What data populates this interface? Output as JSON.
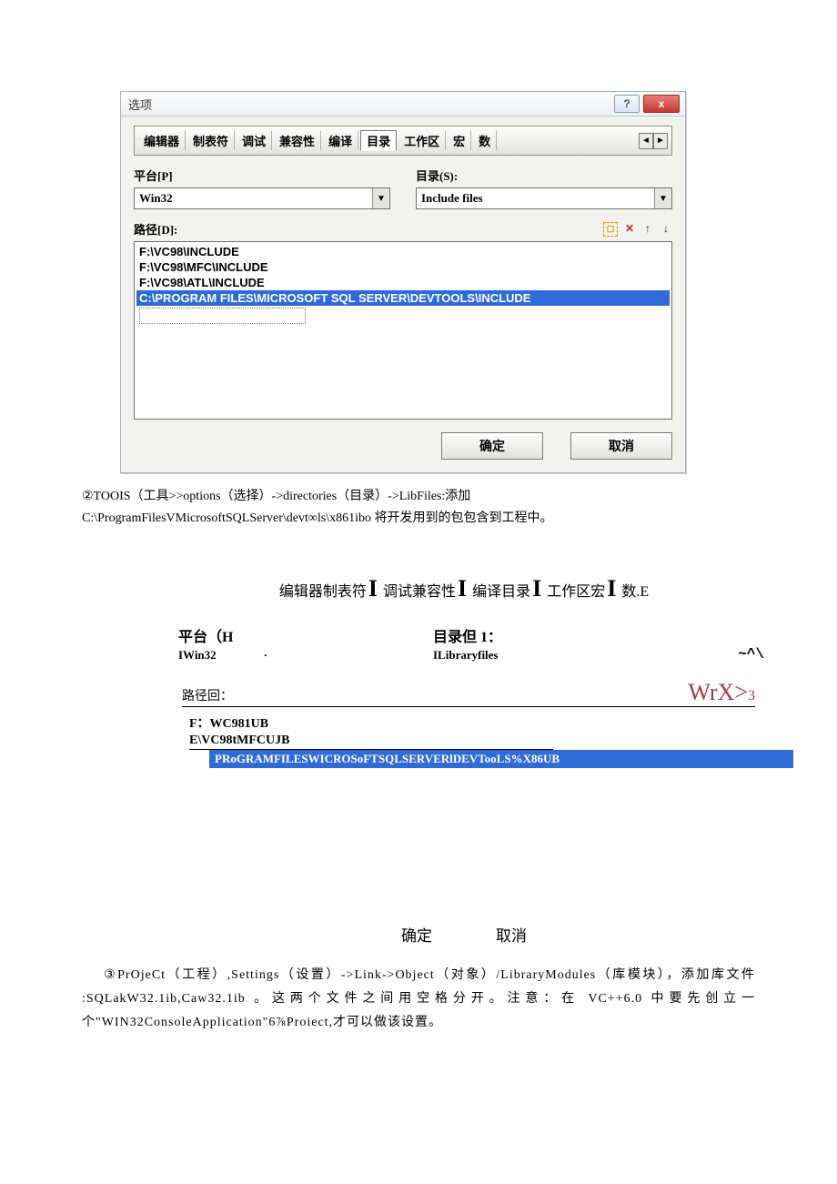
{
  "dlg1": {
    "title": "选项",
    "help_btn": "?",
    "close_btn": "x",
    "tabs": [
      "编辑器",
      "制表符",
      "调试",
      "兼容性",
      "编译",
      "目录",
      "工作区",
      "宏",
      "数"
    ],
    "arrow_left": "◄",
    "arrow_right": "►",
    "platform_label": "平台[P]",
    "platform_value": "Win32",
    "dirtype_label": "目录(S):",
    "dirtype_value": "Include files",
    "paths_label": "路径[D]:",
    "icon_new": "▢",
    "icon_del": "✕",
    "icon_up": "↑",
    "icon_down": "↓",
    "paths": [
      "F:\\VC98\\INCLUDE",
      "F:\\VC98\\MFC\\INCLUDE",
      "F:\\VC98\\ATL\\INCLUDE",
      "C:\\PROGRAM FILES\\MICROSOFT SQL SERVER\\DEVTOOLS\\INCLUDE"
    ],
    "ok": "确定",
    "cancel": "取消"
  },
  "para2a": "②TOOIS（工具>>options（选择）->directories（目录）->LibFiles:添加",
  "para2b": "C:\\ProgramFilesVMicrosoftSQLServer\\devt∞ls\\x861ibo 将开发用到的包包含到工程中。",
  "dlg2": {
    "tabs_text": [
      "编辑器制表符",
      "调试兼容性",
      "编译目录",
      "工作区宏",
      "数.E"
    ],
    "platform_label": "平台（H",
    "platform_value": "IWin32",
    "platform_dot": "·",
    "dirtype_label": "目录但 1：",
    "dirtype_value": "ILibraryfiles",
    "tail": "~^\\",
    "paths_label": "路径回：",
    "wrx": "WrX>",
    "wrx3": "3",
    "p1": "F：WC981UB",
    "p2": "E\\VC98tMFCUJB",
    "p3": "PRoGRAMFILESWICROSoFTSQLSERVERlDEVTooLS%X86UB",
    "ok": "确定",
    "cancel": "取消"
  },
  "para3": "③PrOjeCt（工程）,Settings（设置）->Link->Object（对象）/LibraryModules（库模块），添加库文件 :SQLakW32.1ib,Caw32.1ib 。这两个文件之间用空格分开。注意：在 VC++6.0 中要先创立一个\"WIN32ConsoleApplication\"6⅞Proiect,才可以做该设置。"
}
